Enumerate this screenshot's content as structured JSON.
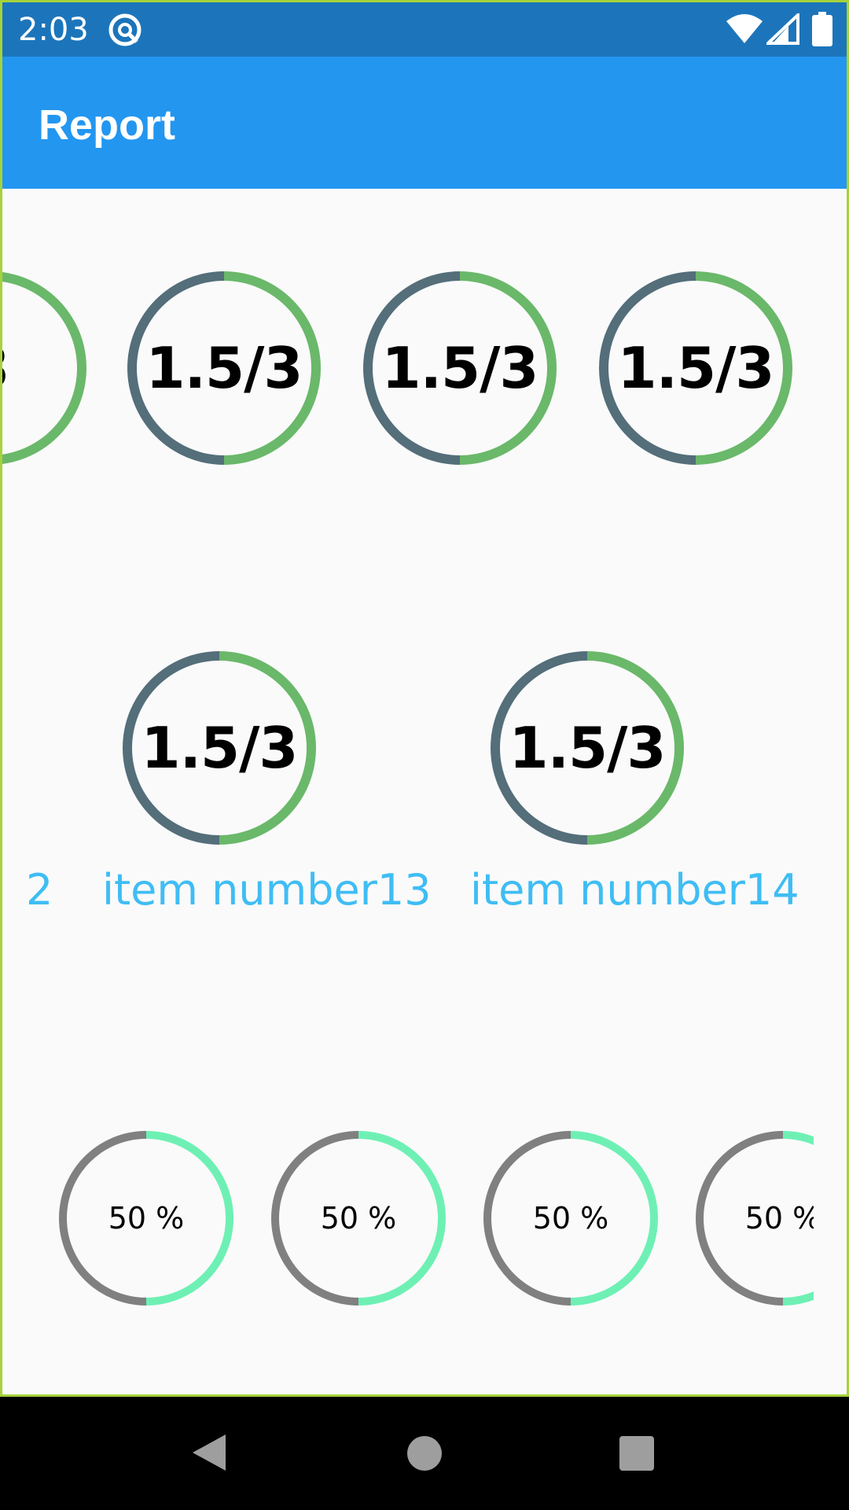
{
  "status_bar": {
    "time": "2:03"
  },
  "app_bar": {
    "title": "Report"
  },
  "colors": {
    "status_bar": "#1c75bb",
    "app_bar": "#2396f0",
    "progress_filled_big": "#6ab86a",
    "progress_track_big": "#546e7a",
    "progress_filled_small": "#6ef0b4",
    "progress_track_small": "#808080",
    "item_label": "#3fbdf4"
  },
  "big_score": {
    "text": "1.5/3",
    "progress": 0.5
  },
  "small_percent": {
    "text": "50 %",
    "progress": 0.5
  },
  "row1_partial_text": "3",
  "row2": {
    "partial_label": "2",
    "items": [
      {
        "label": "item number13"
      },
      {
        "label": "item number14"
      }
    ]
  }
}
